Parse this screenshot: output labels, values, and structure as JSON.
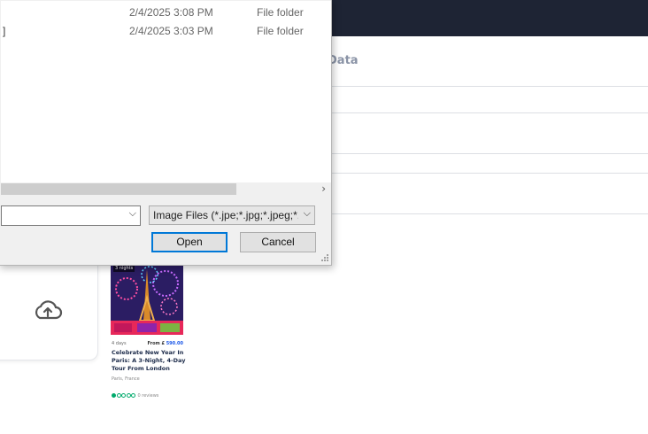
{
  "page": {
    "tab_label": "Data",
    "upload": {
      "icon": "cloud-upload-icon"
    }
  },
  "tour_card": {
    "image_tag": "3 nights",
    "days": "4 days",
    "price_prefix": "From £",
    "price": "590.00",
    "title": "Celebrate New Year In Paris: A 3-Night, 4-Day Tour From London",
    "location": "Paris, France",
    "rating": 1,
    "rating_max": 5,
    "reviews": "0 reviews",
    "accent_color": "#00aa6c"
  },
  "dialog": {
    "files": [
      {
        "name": "",
        "date": "2/4/2025 3:08 PM",
        "type": "File folder"
      },
      {
        "name": "]",
        "date": "2/4/2025 3:03 PM",
        "type": "File folder"
      }
    ],
    "filename_value": "",
    "filetype_value": "Image Files (*.jpe;*.jpg;*.jpeg;*.",
    "open_label": "Open",
    "cancel_label": "Cancel",
    "focus_color": "#0078d7"
  }
}
